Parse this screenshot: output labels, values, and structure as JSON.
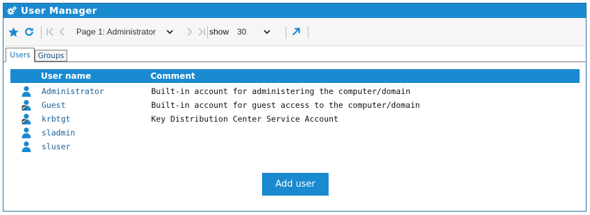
{
  "window": {
    "title": "User Manager",
    "icon": "gear-icon"
  },
  "toolbar": {
    "page_label": "Page 1: Administrator",
    "show_label": "show",
    "show_value": "30",
    "icons": [
      "star-icon",
      "refresh-icon",
      "first-page-icon",
      "prev-page-icon",
      "chevron-down-icon",
      "next-page-icon",
      "last-page-icon",
      "external-link-icon"
    ]
  },
  "tabs": [
    {
      "label": "Users",
      "active": true
    },
    {
      "label": "Groups",
      "active": false
    }
  ],
  "grid": {
    "columns": [
      "User name",
      "Comment"
    ],
    "rows": [
      {
        "name": "Administrator",
        "comment": "Built-in account for administering the computer/domain",
        "disabled": false
      },
      {
        "name": "Guest",
        "comment": "Built-in account for guest access to the computer/domain",
        "disabled": true
      },
      {
        "name": "krbtgt",
        "comment": "Key Distribution Center Service Account",
        "disabled": true
      },
      {
        "name": "sladmin",
        "comment": "",
        "disabled": false
      },
      {
        "name": "sluser",
        "comment": "",
        "disabled": false
      }
    ]
  },
  "add_button": {
    "label": "Add user"
  },
  "colors": {
    "accent": "#1a8ad0",
    "link": "#1a5f96",
    "toolbar_bg": "#f6f6f6"
  }
}
